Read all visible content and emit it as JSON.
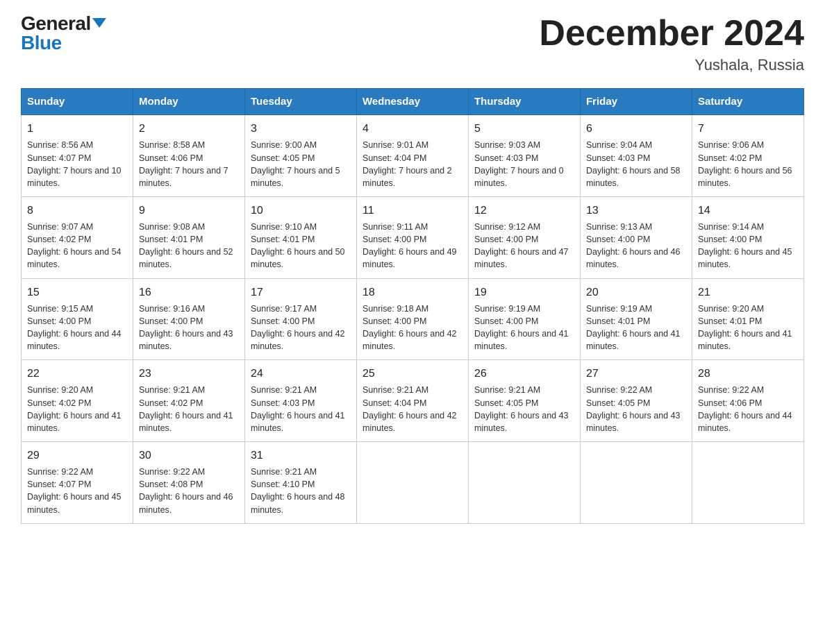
{
  "logo": {
    "general": "General",
    "blue": "Blue"
  },
  "header": {
    "month": "December 2024",
    "location": "Yushala, Russia"
  },
  "weekdays": [
    "Sunday",
    "Monday",
    "Tuesday",
    "Wednesday",
    "Thursday",
    "Friday",
    "Saturday"
  ],
  "weeks": [
    [
      {
        "day": "1",
        "sunrise": "8:56 AM",
        "sunset": "4:07 PM",
        "daylight": "7 hours and 10 minutes."
      },
      {
        "day": "2",
        "sunrise": "8:58 AM",
        "sunset": "4:06 PM",
        "daylight": "7 hours and 7 minutes."
      },
      {
        "day": "3",
        "sunrise": "9:00 AM",
        "sunset": "4:05 PM",
        "daylight": "7 hours and 5 minutes."
      },
      {
        "day": "4",
        "sunrise": "9:01 AM",
        "sunset": "4:04 PM",
        "daylight": "7 hours and 2 minutes."
      },
      {
        "day": "5",
        "sunrise": "9:03 AM",
        "sunset": "4:03 PM",
        "daylight": "7 hours and 0 minutes."
      },
      {
        "day": "6",
        "sunrise": "9:04 AM",
        "sunset": "4:03 PM",
        "daylight": "6 hours and 58 minutes."
      },
      {
        "day": "7",
        "sunrise": "9:06 AM",
        "sunset": "4:02 PM",
        "daylight": "6 hours and 56 minutes."
      }
    ],
    [
      {
        "day": "8",
        "sunrise": "9:07 AM",
        "sunset": "4:02 PM",
        "daylight": "6 hours and 54 minutes."
      },
      {
        "day": "9",
        "sunrise": "9:08 AM",
        "sunset": "4:01 PM",
        "daylight": "6 hours and 52 minutes."
      },
      {
        "day": "10",
        "sunrise": "9:10 AM",
        "sunset": "4:01 PM",
        "daylight": "6 hours and 50 minutes."
      },
      {
        "day": "11",
        "sunrise": "9:11 AM",
        "sunset": "4:00 PM",
        "daylight": "6 hours and 49 minutes."
      },
      {
        "day": "12",
        "sunrise": "9:12 AM",
        "sunset": "4:00 PM",
        "daylight": "6 hours and 47 minutes."
      },
      {
        "day": "13",
        "sunrise": "9:13 AM",
        "sunset": "4:00 PM",
        "daylight": "6 hours and 46 minutes."
      },
      {
        "day": "14",
        "sunrise": "9:14 AM",
        "sunset": "4:00 PM",
        "daylight": "6 hours and 45 minutes."
      }
    ],
    [
      {
        "day": "15",
        "sunrise": "9:15 AM",
        "sunset": "4:00 PM",
        "daylight": "6 hours and 44 minutes."
      },
      {
        "day": "16",
        "sunrise": "9:16 AM",
        "sunset": "4:00 PM",
        "daylight": "6 hours and 43 minutes."
      },
      {
        "day": "17",
        "sunrise": "9:17 AM",
        "sunset": "4:00 PM",
        "daylight": "6 hours and 42 minutes."
      },
      {
        "day": "18",
        "sunrise": "9:18 AM",
        "sunset": "4:00 PM",
        "daylight": "6 hours and 42 minutes."
      },
      {
        "day": "19",
        "sunrise": "9:19 AM",
        "sunset": "4:00 PM",
        "daylight": "6 hours and 41 minutes."
      },
      {
        "day": "20",
        "sunrise": "9:19 AM",
        "sunset": "4:01 PM",
        "daylight": "6 hours and 41 minutes."
      },
      {
        "day": "21",
        "sunrise": "9:20 AM",
        "sunset": "4:01 PM",
        "daylight": "6 hours and 41 minutes."
      }
    ],
    [
      {
        "day": "22",
        "sunrise": "9:20 AM",
        "sunset": "4:02 PM",
        "daylight": "6 hours and 41 minutes."
      },
      {
        "day": "23",
        "sunrise": "9:21 AM",
        "sunset": "4:02 PM",
        "daylight": "6 hours and 41 minutes."
      },
      {
        "day": "24",
        "sunrise": "9:21 AM",
        "sunset": "4:03 PM",
        "daylight": "6 hours and 41 minutes."
      },
      {
        "day": "25",
        "sunrise": "9:21 AM",
        "sunset": "4:04 PM",
        "daylight": "6 hours and 42 minutes."
      },
      {
        "day": "26",
        "sunrise": "9:21 AM",
        "sunset": "4:05 PM",
        "daylight": "6 hours and 43 minutes."
      },
      {
        "day": "27",
        "sunrise": "9:22 AM",
        "sunset": "4:05 PM",
        "daylight": "6 hours and 43 minutes."
      },
      {
        "day": "28",
        "sunrise": "9:22 AM",
        "sunset": "4:06 PM",
        "daylight": "6 hours and 44 minutes."
      }
    ],
    [
      {
        "day": "29",
        "sunrise": "9:22 AM",
        "sunset": "4:07 PM",
        "daylight": "6 hours and 45 minutes."
      },
      {
        "day": "30",
        "sunrise": "9:22 AM",
        "sunset": "4:08 PM",
        "daylight": "6 hours and 46 minutes."
      },
      {
        "day": "31",
        "sunrise": "9:21 AM",
        "sunset": "4:10 PM",
        "daylight": "6 hours and 48 minutes."
      },
      null,
      null,
      null,
      null
    ]
  ]
}
